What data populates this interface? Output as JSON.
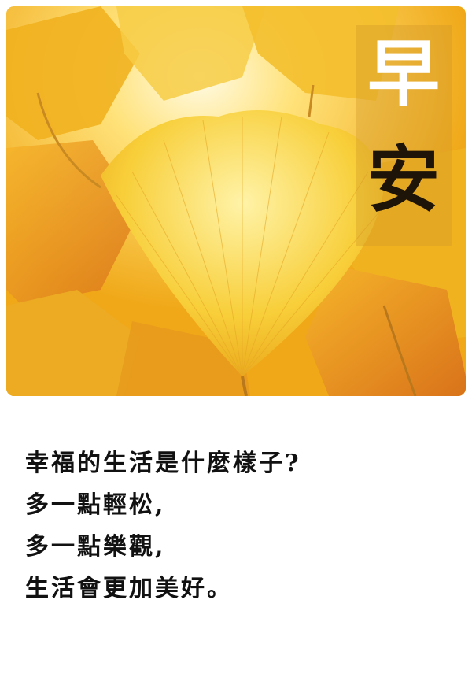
{
  "title": {
    "line1": "早",
    "line2": "安"
  },
  "poem": {
    "lines": [
      "幸福的生活是什麼樣子?",
      "多一點輕松,",
      "多一點樂觀,",
      "生活會更加美好。"
    ]
  },
  "colors": {
    "leaf_gold": "#f2b51a",
    "leaf_light": "#ffe680",
    "leaf_orange": "#e08a1a",
    "background": "#ffffff",
    "text": "#111111"
  }
}
